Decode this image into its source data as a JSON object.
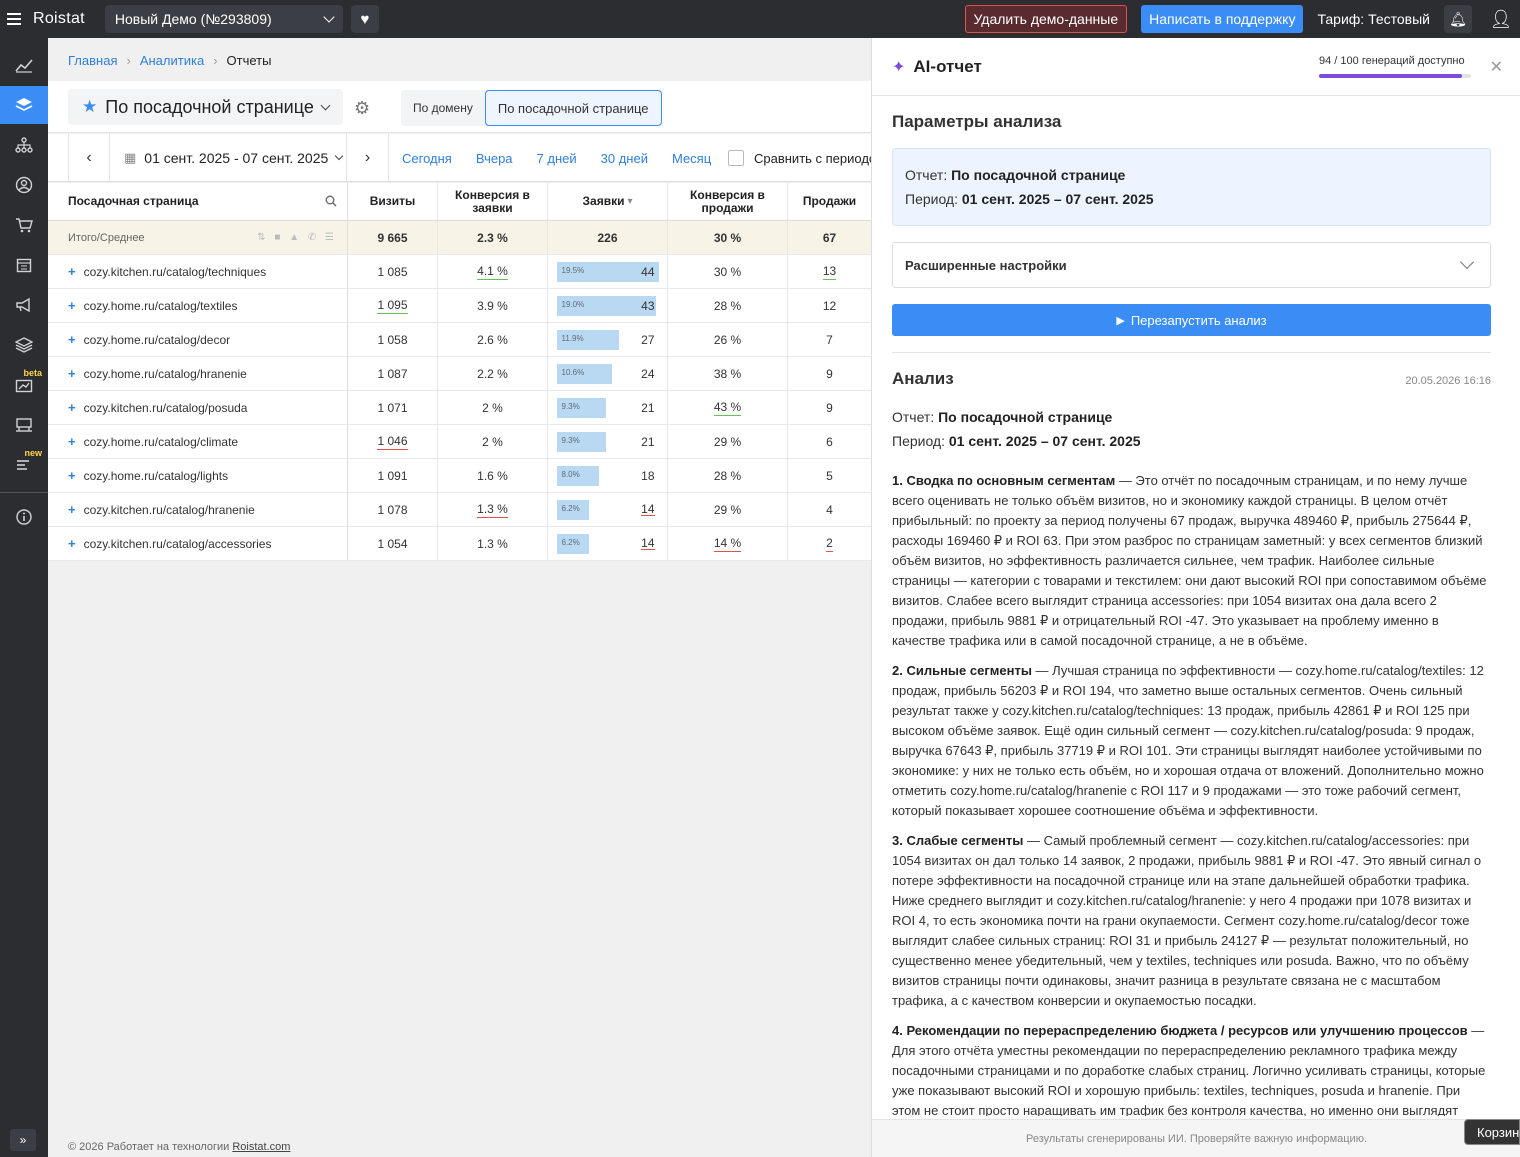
{
  "app": {
    "logo": "Roistat",
    "project": "Новый Демо (№293809)",
    "delete_demo": "Удалить демо-данные",
    "support": "Написать в поддержку",
    "tariff": "Тариф: Тестовый"
  },
  "sidebar": {
    "items": [
      {
        "icon": "chart-icon"
      },
      {
        "icon": "layers-icon",
        "active": true
      },
      {
        "icon": "hierarchy-icon"
      },
      {
        "icon": "user-circle-icon"
      },
      {
        "icon": "cart-icon"
      },
      {
        "icon": "calendar-icon"
      },
      {
        "icon": "megaphone-icon"
      },
      {
        "icon": "stack-icon"
      },
      {
        "icon": "analytics-icon",
        "badge": "beta"
      },
      {
        "icon": "store-icon"
      },
      {
        "icon": "bars-icon",
        "badge": "new"
      },
      {
        "icon": "info-icon"
      }
    ]
  },
  "breadcrumb": {
    "home": "Главная",
    "analytics": "Аналитика",
    "current": "Отчеты"
  },
  "report": {
    "title": "По посадочной странице",
    "group_tabs": [
      "По домену",
      "По посадочной странице"
    ],
    "date_range": "01 сент. 2025 - 07 сент. 2025",
    "quick_dates": [
      "Сегодня",
      "Вчера",
      "7 дней",
      "30 дней",
      "Месяц"
    ],
    "compare": "Сравнить с периодом"
  },
  "table": {
    "headers": [
      "Посадочная страница",
      "Визиты",
      "Конверсия в заявки",
      "Заявки",
      "Конверсия в продажи",
      "Продажи"
    ],
    "sort_mark": "▾",
    "total": {
      "label": "Итого/Среднее",
      "visits": "9 665",
      "conv_leads": "2.3 %",
      "leads": "226",
      "conv_sales": "30 %",
      "sales": "67"
    },
    "rows": [
      {
        "page": "cozy.kitchen.ru/catalog/techniques",
        "visits": "1 085",
        "conv_leads": "4.1 %",
        "leads_pct": "19.5%",
        "leads": "44",
        "conv_sales": "30 %",
        "sales": "13"
      },
      {
        "page": "cozy.home.ru/catalog/textiles",
        "visits": "1 095",
        "conv_leads": "3.9 %",
        "leads_pct": "19.0%",
        "leads": "43",
        "conv_sales": "28 %",
        "sales": "12"
      },
      {
        "page": "cozy.home.ru/catalog/decor",
        "visits": "1 058",
        "conv_leads": "2.6 %",
        "leads_pct": "11.9%",
        "leads": "27",
        "conv_sales": "26 %",
        "sales": "7"
      },
      {
        "page": "cozy.home.ru/catalog/hranenie",
        "visits": "1 087",
        "conv_leads": "2.2 %",
        "leads_pct": "10.6%",
        "leads": "24",
        "conv_sales": "38 %",
        "sales": "9"
      },
      {
        "page": "cozy.kitchen.ru/catalog/posuda",
        "visits": "1 071",
        "conv_leads": "2 %",
        "leads_pct": "9.3%",
        "leads": "21",
        "conv_sales": "43 %",
        "sales": "9"
      },
      {
        "page": "cozy.home.ru/catalog/climate",
        "visits": "1 046",
        "conv_leads": "2 %",
        "leads_pct": "9.3%",
        "leads": "21",
        "conv_sales": "29 %",
        "sales": "6"
      },
      {
        "page": "cozy.home.ru/catalog/lights",
        "visits": "1 091",
        "conv_leads": "1.6 %",
        "leads_pct": "8.0%",
        "leads": "18",
        "conv_sales": "28 %",
        "sales": "5"
      },
      {
        "page": "cozy.kitchen.ru/catalog/hranenie",
        "visits": "1 078",
        "conv_leads": "1.3 %",
        "leads_pct": "6.2%",
        "leads": "14",
        "conv_sales": "29 %",
        "sales": "4"
      },
      {
        "page": "cozy.kitchen.ru/catalog/accessories",
        "visits": "1 054",
        "conv_leads": "1.3 %",
        "leads_pct": "6.2%",
        "leads": "14",
        "conv_sales": "14 %",
        "sales": "2"
      }
    ]
  },
  "footer": {
    "text": "© 2026 Работает на технологии ",
    "link": "Roistat.com"
  },
  "ai_panel": {
    "title": "AI-отчет",
    "generations": "94 / 100 генераций доступно",
    "params_title": "Параметры анализа",
    "report_label": "Отчет: ",
    "report_value": "По посадочной странице",
    "period_label": "Период: ",
    "period_value": "01 сент. 2025 – 07 сент. 2025",
    "advanced": "Расширенные настройки",
    "rerun": "Перезапустить анализ",
    "analysis_title": "Анализ",
    "analysis_date": "20.05.2026 16:16",
    "sections": [
      {
        "title": "1. Сводка по основным сегментам",
        "text": " — Это отчёт по посадочным страницам, и по нему лучше всего оценивать не только объём визитов, но и экономику каждой страницы. В целом отчёт прибыльный: по проекту за период получены 67 продаж, выручка 489460 ₽, прибыль 275644 ₽, расходы 169460 ₽ и ROI 63. При этом разброс по страницам заметный: у всех сегментов близкий объём визитов, но эффективность различается сильнее, чем трафик. Наиболее сильные страницы — категории с товарами и текстилем: они дают высокий ROI при сопоставимом объёме визитов. Слабее всего выглядит страница accessories: при 1054 визитах она дала всего 2 продажи, прибыль 9881 ₽ и отрицательный ROI -47. Это указывает на проблему именно в качестве трафика или в самой посадочной странице, а не в объёме."
      },
      {
        "title": "2. Сильные сегменты",
        "text": " — Лучшая страница по эффективности — cozy.home.ru/catalog/textiles: 12 продаж, прибыль 56203 ₽ и ROI 194, что заметно выше остальных сегментов. Очень сильный результат также у cozy.kitchen.ru/catalog/techniques: 13 продаж, прибыль 42861 ₽ и ROI 125 при высоком объёме заявок. Ещё один сильный сегмент — cozy.kitchen.ru/catalog/posuda: 9 продаж, выручка 67643 ₽, прибыль 37719 ₽ и ROI 101. Эти страницы выглядят наиболее устойчивыми по экономике: у них не только есть объём, но и хорошая отдача от вложений. Дополнительно можно отметить cozy.home.ru/catalog/hranenie с ROI 117 и 9 продажами — это тоже рабочий сегмент, который показывает хорошее соотношение объёма и эффективности."
      },
      {
        "title": "3. Слабые сегменты",
        "text": " — Самый проблемный сегмент — cozy.kitchen.ru/catalog/accessories: при 1054 визитах он дал только 14 заявок, 2 продажи, прибыль 9881 ₽ и ROI -47. Это явный сигнал о потере эффективности на посадочной странице или на этапе дальнейшей обработки трафика. Ниже среднего выглядит и cozy.kitchen.ru/catalog/hranenie: у него 4 продажи при 1078 визитах и ROI 4, то есть экономика почти на грани окупаемости. Сегмент cozy.home.ru/catalog/decor тоже выглядит слабее сильных страниц: ROI 31 и прибыль 24127 ₽ — результат положительный, но существенно менее убедительный, чем у textiles, techniques или posuda. Важно, что по объёму визитов страницы почти одинаковы, значит разница в результате связана не с масштабом трафика, а с качеством конверсии и окупаемостью посадки."
      },
      {
        "title": "4. Рекомендации по перераспределению бюджета / ресурсов или улучшению процессов",
        "text": " — Для этого отчёта уместны рекомендации по перераспределению рекламного трафика между посадочными страницами и по доработке слабых страниц. Логично усиливать страницы, которые уже показывают высокий ROI и хорошую прибыль: textiles, techniques, posuda и hranenie. При этом не стоит просто наращивать им трафик без контроля качества, но именно они выглядят"
      }
    ],
    "footer": "Результаты сгенерированы ИИ. Проверяйте важную информацию.",
    "cart_tooltip": "Корзина"
  },
  "colors": {
    "accent": "#3a8df5",
    "topbar": "#2b2d31",
    "ai": "#7c4ddb",
    "bar": "#b9d8f2",
    "good": "#6bbf59",
    "bad": "#e0524d"
  }
}
